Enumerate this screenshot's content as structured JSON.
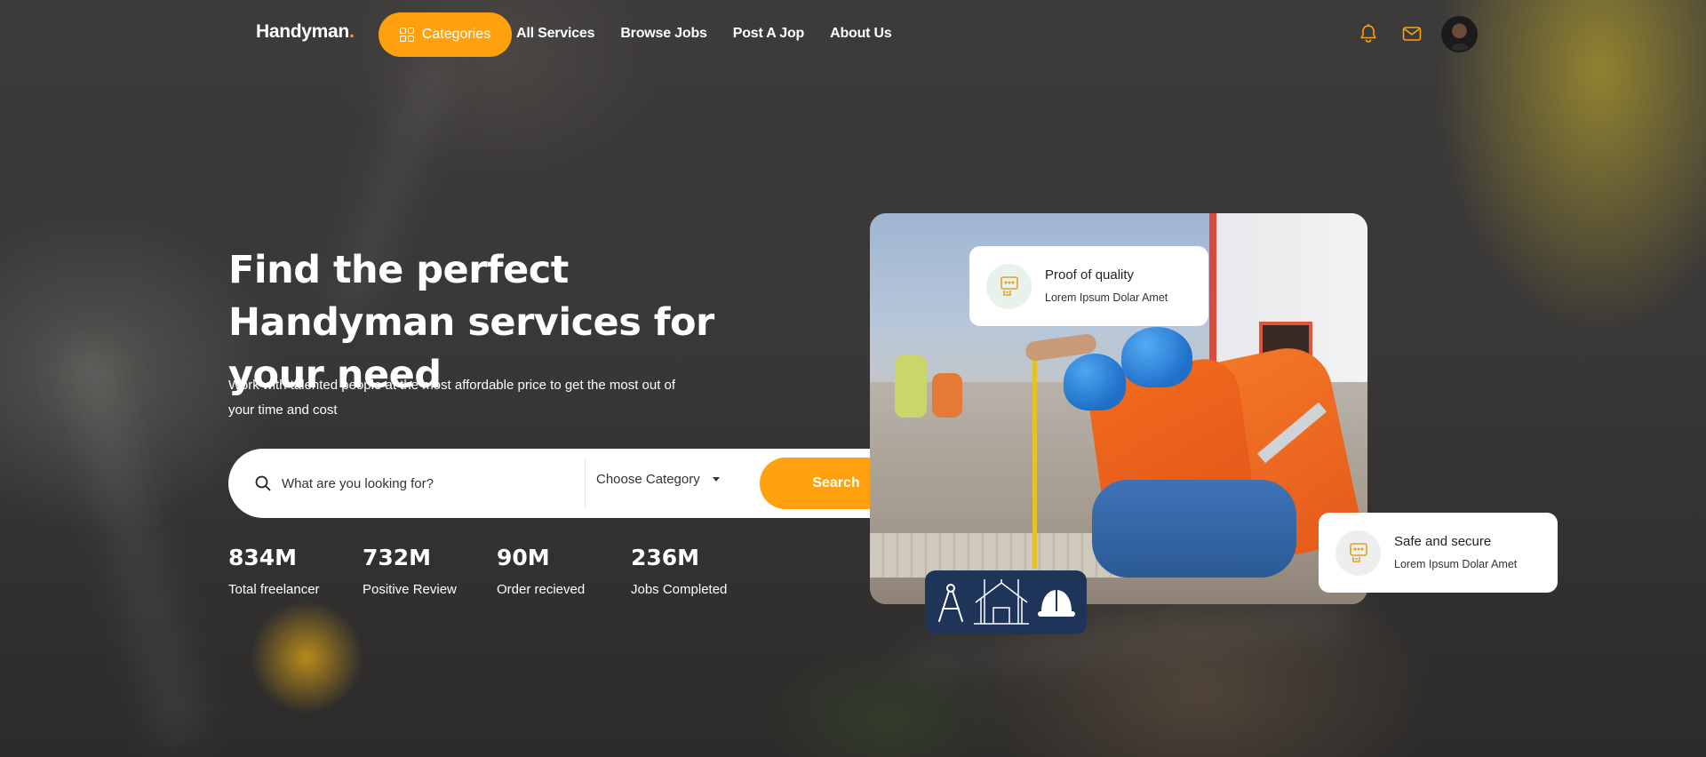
{
  "nav": {
    "logo_text": "Handyman",
    "logo_dot": ".",
    "categories_label": "Categories",
    "links": [
      "All Services",
      "Browse Jobs",
      "Post A Jop",
      "About Us"
    ],
    "icons": [
      "bell-icon",
      "mail-icon",
      "avatar"
    ],
    "accent_color": "#ffa10f"
  },
  "hero": {
    "title": "Find the perfect Handyman services for your need",
    "subtitle": "Work with talented people at the most affordable price to get the most out of your time and cost"
  },
  "search": {
    "placeholder": "What are you looking for?",
    "category_label": "Choose Category",
    "button_label": "Search"
  },
  "stats": [
    {
      "value": "834M",
      "label": "Total freelancer"
    },
    {
      "value": "732M",
      "label": "Positive Review"
    },
    {
      "value": "90M",
      "label": "Order recieved"
    },
    {
      "value": "236M",
      "label": "Jobs Completed"
    }
  ],
  "cards": [
    {
      "title": "Proof of quality",
      "subtitle": "Lorem Ipsum Dolar Amet"
    },
    {
      "title": "Safe and secure",
      "subtitle": "Lorem Ipsum Dolar Amet"
    }
  ]
}
